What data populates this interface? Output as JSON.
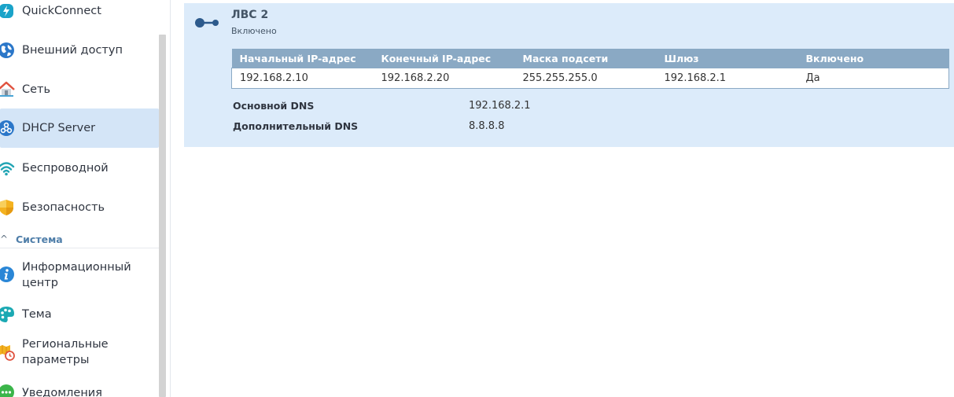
{
  "sidebar": {
    "items": [
      {
        "label": "QuickConnect",
        "icon": "quickconnect-icon"
      },
      {
        "label": "Внешний доступ",
        "icon": "globe-icon"
      },
      {
        "label": "Сеть",
        "icon": "house-icon"
      },
      {
        "label": "DHCP Server",
        "icon": "dhcp-icon",
        "selected": true
      },
      {
        "label": "Беспроводной",
        "icon": "wifi-icon"
      },
      {
        "label": "Безопасность",
        "icon": "shield-icon"
      }
    ],
    "section": {
      "label": "Система",
      "chevron": "^",
      "items": [
        {
          "label": "Информационный центр",
          "icon": "info-icon"
        },
        {
          "label": "Тема",
          "icon": "palette-icon"
        },
        {
          "label": "Региональные параметры",
          "icon": "map-clock-icon"
        },
        {
          "label": "Уведомления",
          "icon": "notification-icon"
        }
      ]
    }
  },
  "lan": {
    "title": "ЛВС 2",
    "status": "Включено",
    "table": {
      "headers": [
        "Начальный IP-адрес",
        "Конечный IP-адрес",
        "Маска подсети",
        "Шлюз",
        "Включено"
      ],
      "rows": [
        [
          "192.168.2.10",
          "192.168.2.20",
          "255.255.255.0",
          "192.168.2.1",
          "Да"
        ]
      ]
    },
    "dns": [
      {
        "label": "Основной DNS",
        "value": "192.168.2.1"
      },
      {
        "label": "Дополнительный DNS",
        "value": "8.8.8.8"
      }
    ]
  },
  "colors": {
    "selected_bg": "#d4e5f7",
    "card_bg": "#dcebfa",
    "table_header_bg": "#8aa9c4",
    "section_label": "#4f7ea9"
  }
}
